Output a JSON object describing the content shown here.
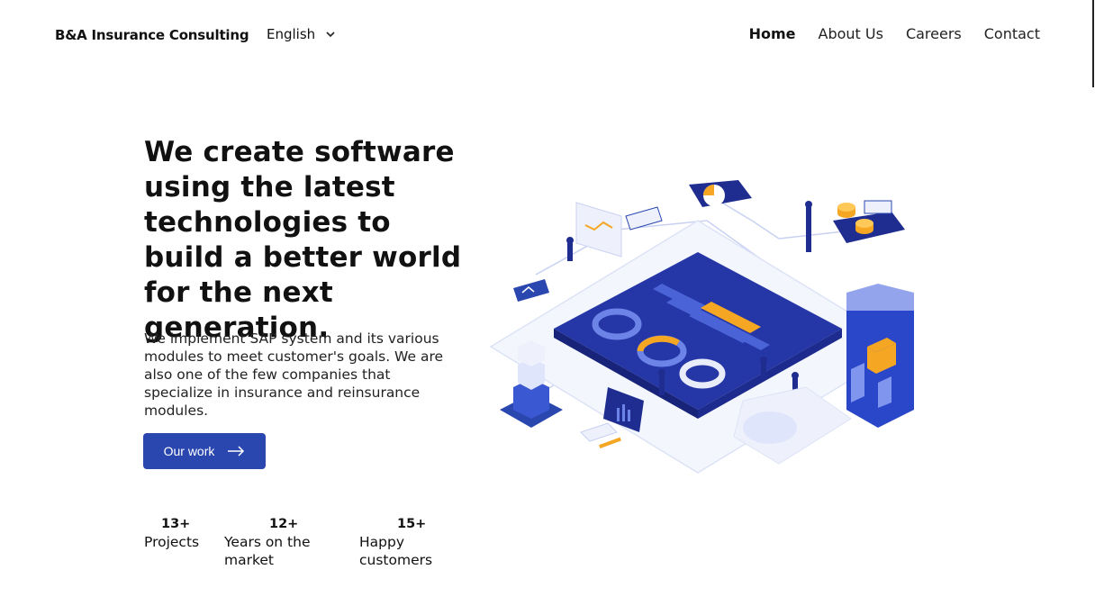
{
  "header": {
    "brand": "B&A Insurance Consulting",
    "language": "English",
    "nav": [
      {
        "label": "Home",
        "active": true
      },
      {
        "label": "About Us",
        "active": false
      },
      {
        "label": "Careers",
        "active": false
      },
      {
        "label": "Contact",
        "active": false
      }
    ]
  },
  "hero": {
    "title": "We create software using the latest technologies to build a better world for the next generation.",
    "description": "We implement SAP system and its various modules to meet customer's goals. We are also one of the few companies that specialize in insurance and reinsurance modules.",
    "cta_label": "Our work",
    "cta_icon": "arrow-right-icon"
  },
  "stats": [
    {
      "value": "13+",
      "label": "Projects"
    },
    {
      "value": "12+",
      "label": "Years on the market"
    },
    {
      "value": "15+",
      "label": "Happy customers"
    }
  ],
  "colors": {
    "accent": "#2a47b0",
    "illustration_dark": "#1e2d8f",
    "illustration_light": "#e8ecfb",
    "highlight": "#f5a623"
  }
}
